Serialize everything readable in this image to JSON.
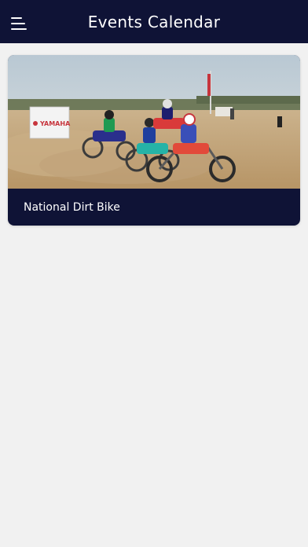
{
  "header": {
    "title": "Events Calendar",
    "menu_icon": "hamburger-menu-icon",
    "background": "#0f1336"
  },
  "events": [
    {
      "name": "National Dirt Bike",
      "image": "motocross-race-start-photo",
      "banner_text": "YAMAHA"
    }
  ]
}
